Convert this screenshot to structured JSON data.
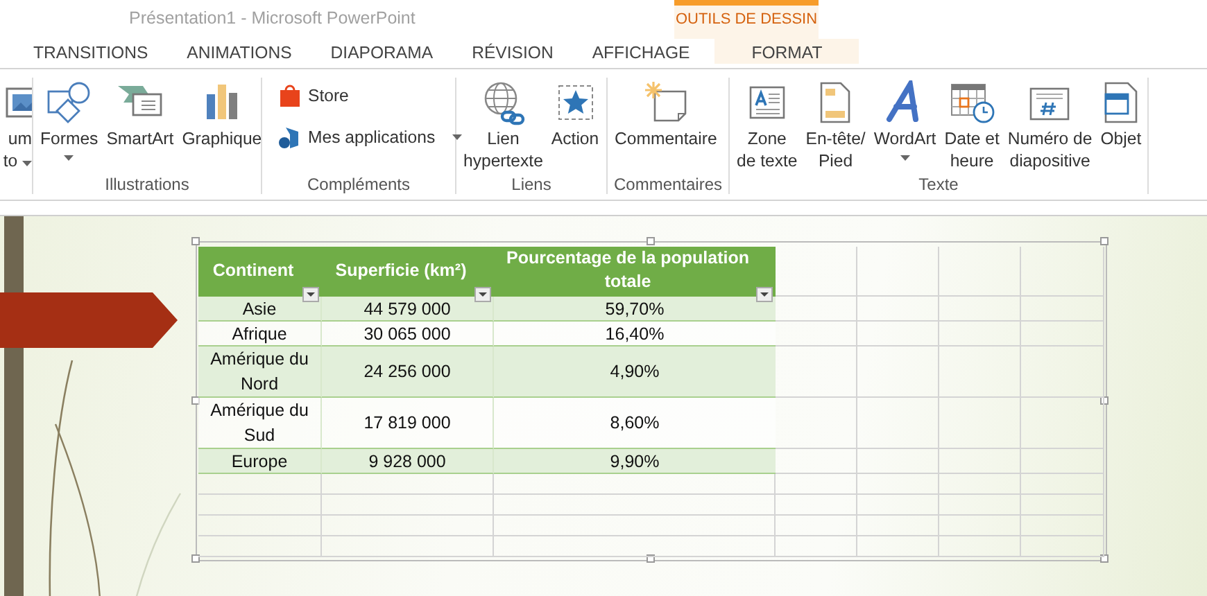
{
  "window": {
    "title": "Présentation1 - Microsoft PowerPoint"
  },
  "contextual_group": {
    "label": "OUTILS DE DESSIN"
  },
  "tabs": [
    {
      "label": "TRANSITIONS",
      "selected": false,
      "kind": "normal"
    },
    {
      "label": "ANIMATIONS",
      "selected": false,
      "kind": "normal"
    },
    {
      "label": "DIAPORAMA",
      "selected": false,
      "kind": "normal"
    },
    {
      "label": "RÉVISION",
      "selected": false,
      "kind": "normal"
    },
    {
      "label": "AFFICHAGE",
      "selected": false,
      "kind": "normal"
    },
    {
      "label": "FORMAT",
      "selected": false,
      "kind": "contextual"
    }
  ],
  "ribbon": {
    "groups": [
      {
        "items": [
          {
            "kind": "partial",
            "lines": [
              "um",
              "to"
            ],
            "dropdown": true
          }
        ]
      },
      {
        "label": "Illustrations",
        "items": [
          {
            "kind": "large",
            "lines": [
              "Formes"
            ],
            "dropdown": true
          },
          {
            "kind": "large",
            "lines": [
              "SmartArt"
            ],
            "dropdown": false
          },
          {
            "kind": "large",
            "lines": [
              "Graphique"
            ],
            "dropdown": false
          }
        ]
      },
      {
        "label": "Compléments",
        "items": [
          {
            "kind": "small",
            "lines": [
              "Store"
            ],
            "dropdown": false
          },
          {
            "kind": "small",
            "lines": [
              "Mes applications"
            ],
            "dropdown": true
          }
        ]
      },
      {
        "label": "Liens",
        "items": [
          {
            "kind": "large",
            "lines": [
              "Lien",
              "hypertexte"
            ],
            "dropdown": false
          },
          {
            "kind": "large",
            "lines": [
              "Action"
            ],
            "dropdown": false
          }
        ]
      },
      {
        "label": "Commentaires",
        "items": [
          {
            "kind": "large",
            "lines": [
              "Commentaire"
            ],
            "dropdown": false
          }
        ]
      },
      {
        "label": "Texte",
        "items": [
          {
            "kind": "large",
            "lines": [
              "Zone",
              "de texte"
            ],
            "dropdown": false
          },
          {
            "kind": "large",
            "lines": [
              "En-tête/",
              "Pied"
            ],
            "dropdown": false
          },
          {
            "kind": "large",
            "lines": [
              "WordArt"
            ],
            "dropdown": true
          },
          {
            "kind": "large",
            "lines": [
              "Date et",
              "heure"
            ],
            "dropdown": false
          },
          {
            "kind": "large",
            "lines": [
              "Numéro de",
              "diapositive"
            ],
            "dropdown": false
          },
          {
            "kind": "large",
            "lines": [
              "Objet"
            ],
            "dropdown": false
          }
        ]
      }
    ]
  },
  "table": {
    "columns": [
      {
        "label": "Continent",
        "filter": true
      },
      {
        "label": "Superficie (km²)",
        "filter": true
      },
      {
        "label": "Pourcentage de la population totale",
        "filter": true
      }
    ],
    "rows": [
      [
        "Asie",
        "44 579 000",
        "59,70%"
      ],
      [
        "Afrique",
        "30 065 000",
        "16,40%"
      ],
      [
        "Amérique du Nord",
        "24 256 000",
        "4,90%"
      ],
      [
        "Amérique du Sud",
        "17 819 000",
        "8,60%"
      ],
      [
        "Europe",
        "9 928 000",
        "9,90%"
      ]
    ]
  }
}
